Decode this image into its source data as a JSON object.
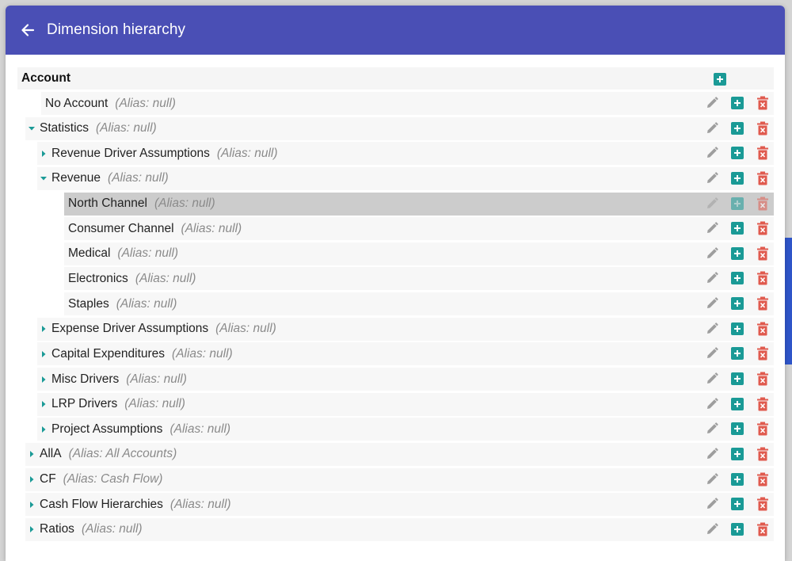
{
  "header": {
    "title": "Dimension hierarchy"
  },
  "root": {
    "label": "Account"
  },
  "colors": {
    "header": "#4a4fb5",
    "add": "#1a9a96",
    "delete": "#e05a4e",
    "edit": "#9e9e9e",
    "caret": "#1a9a96"
  },
  "nodes": [
    {
      "name": "No Account",
      "alias": "(Alias: null)",
      "level": 0,
      "toggle": "none",
      "selected": false
    },
    {
      "name": "Statistics",
      "alias": "(Alias: null)",
      "level": 0,
      "toggle": "expanded",
      "selected": false
    },
    {
      "name": "Revenue Driver Assumptions",
      "alias": "(Alias: null)",
      "level": 1,
      "toggle": "collapsed",
      "selected": false
    },
    {
      "name": "Revenue",
      "alias": "(Alias: null)",
      "level": 1,
      "toggle": "expanded",
      "selected": false
    },
    {
      "name": "North Channel",
      "alias": "(Alias: null)",
      "level": 2,
      "toggle": "none",
      "selected": true
    },
    {
      "name": "Consumer Channel",
      "alias": "(Alias: null)",
      "level": 2,
      "toggle": "none",
      "selected": false
    },
    {
      "name": "Medical",
      "alias": "(Alias: null)",
      "level": 2,
      "toggle": "none",
      "selected": false
    },
    {
      "name": "Electronics",
      "alias": "(Alias: null)",
      "level": 2,
      "toggle": "none",
      "selected": false
    },
    {
      "name": "Staples",
      "alias": "(Alias: null)",
      "level": 2,
      "toggle": "none",
      "selected": false
    },
    {
      "name": "Expense Driver Assumptions",
      "alias": "(Alias: null)",
      "level": 1,
      "toggle": "collapsed",
      "selected": false
    },
    {
      "name": "Capital Expenditures",
      "alias": "(Alias: null)",
      "level": 1,
      "toggle": "collapsed",
      "selected": false
    },
    {
      "name": "Misc Drivers",
      "alias": "(Alias: null)",
      "level": 1,
      "toggle": "collapsed",
      "selected": false
    },
    {
      "name": "LRP Drivers",
      "alias": "(Alias: null)",
      "level": 1,
      "toggle": "collapsed",
      "selected": false
    },
    {
      "name": "Project Assumptions",
      "alias": "(Alias: null)",
      "level": 1,
      "toggle": "collapsed",
      "selected": false
    },
    {
      "name": "AllA",
      "alias": "(Alias: All Accounts)",
      "level": 0,
      "toggle": "collapsed",
      "selected": false
    },
    {
      "name": "CF",
      "alias": "(Alias: Cash Flow)",
      "level": 0,
      "toggle": "collapsed",
      "selected": false
    },
    {
      "name": "Cash Flow Hierarchies",
      "alias": "(Alias: null)",
      "level": 0,
      "toggle": "collapsed",
      "selected": false
    },
    {
      "name": "Ratios",
      "alias": "(Alias: null)",
      "level": 0,
      "toggle": "collapsed",
      "selected": false
    }
  ]
}
